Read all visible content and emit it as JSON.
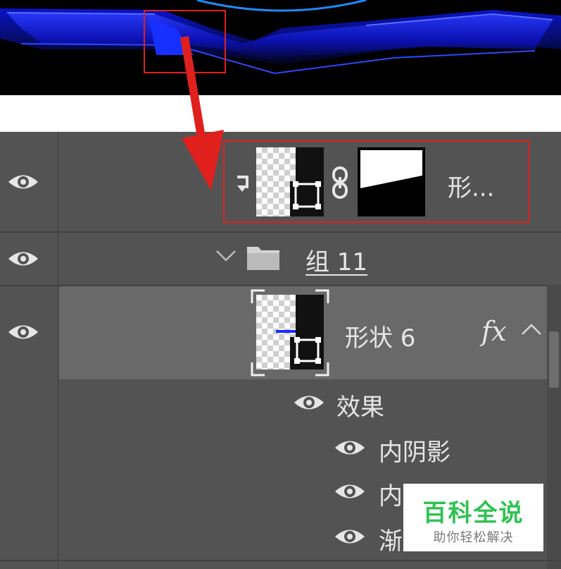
{
  "layers": {
    "clipped_layer": {
      "name": "形..."
    },
    "group": {
      "name": "组 11"
    },
    "shape_layer": {
      "name": "形状 6",
      "fx_label": "fx"
    },
    "effects": {
      "header": "效果",
      "items": [
        {
          "label": "内阴影"
        },
        {
          "label": "内阴影"
        },
        {
          "label": "渐"
        }
      ]
    }
  },
  "watermark": {
    "title": "百科全说",
    "subtitle": "助你轻松解决"
  },
  "colors": {
    "highlight": "#e0201d",
    "panel": "#535353",
    "selected_row": "#696969",
    "canvas_blue": "#1a2cff",
    "watermark_green": "#2fc252"
  }
}
